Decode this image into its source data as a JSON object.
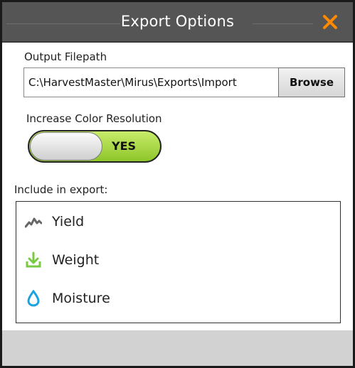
{
  "dialog": {
    "title": "Export Options",
    "accent_color": "#ff8a00"
  },
  "output": {
    "label": "Output Filepath",
    "path_value": "C:\\HarvestMaster\\Mirus\\Exports\\Import",
    "browse_label": "Browse"
  },
  "color_resolution": {
    "label": "Increase Color Resolution",
    "toggle_text": "YES",
    "toggle_color": "#a4d63b"
  },
  "include": {
    "label": "Include in export:",
    "items": [
      {
        "label": "Yield",
        "icon": "yield-chart-icon",
        "icon_color": "#666666"
      },
      {
        "label": "Weight",
        "icon": "download-weight-icon",
        "icon_color": "#7ac943"
      },
      {
        "label": "Moisture",
        "icon": "water-drop-icon",
        "icon_color": "#1aa3e0"
      }
    ]
  }
}
